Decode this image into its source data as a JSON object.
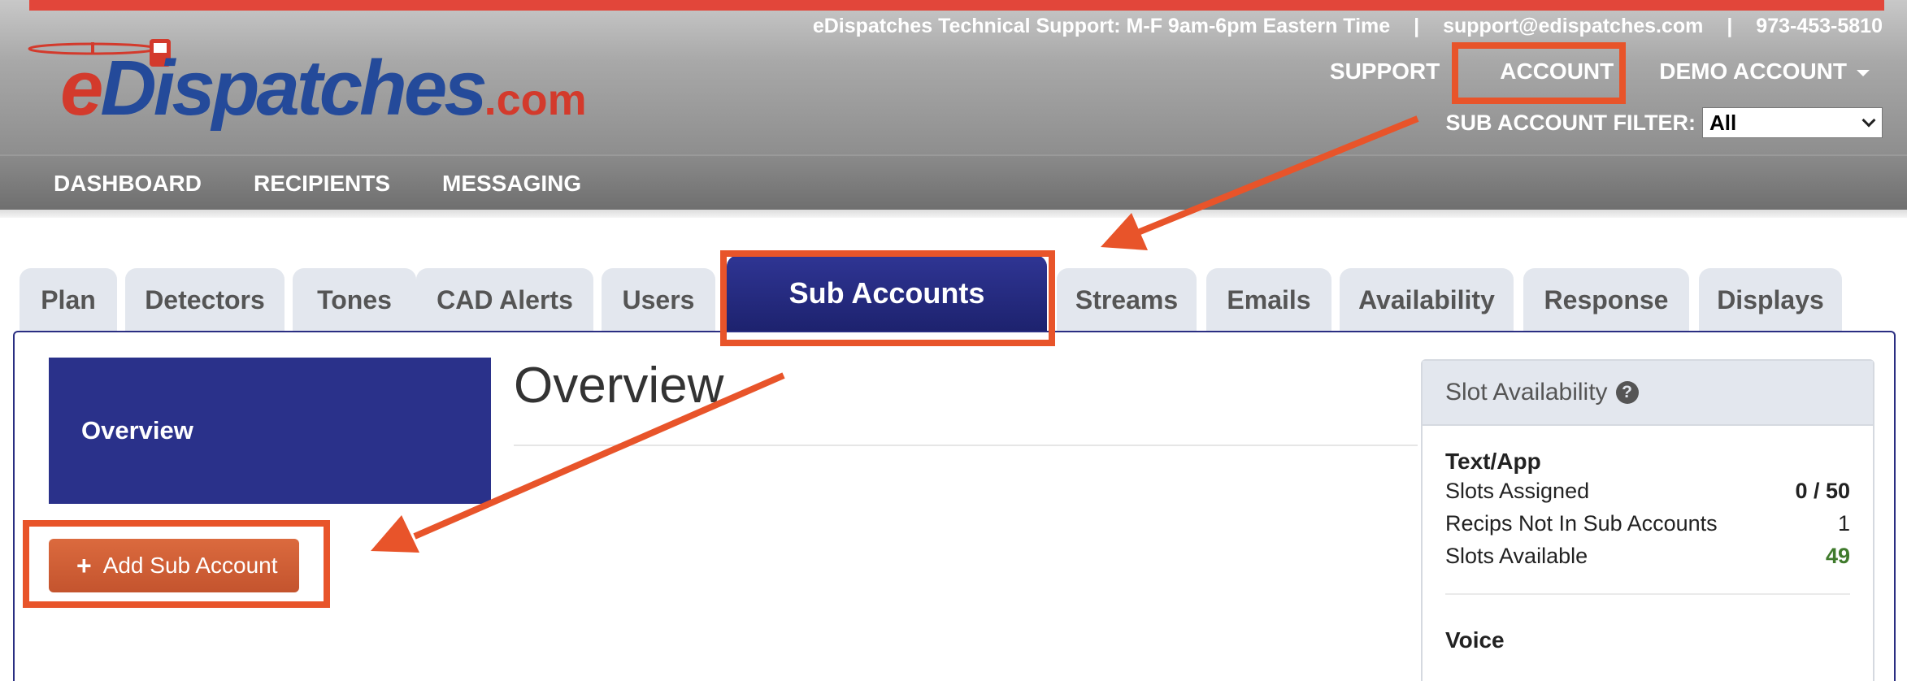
{
  "header": {
    "logo": {
      "prefix": "e",
      "main": "Dispatches",
      "suffix": ".com"
    },
    "support_text": "eDispatches Technical Support: M-F 9am-6pm Eastern Time",
    "support_email": "support@edispatches.com",
    "support_phone": "973-453-5810",
    "separator": "|",
    "top_nav": {
      "support": "SUPPORT",
      "account": "ACCOUNT",
      "demo_account": "DEMO ACCOUNT"
    },
    "sub_account_filter": {
      "label": "SUB ACCOUNT FILTER:",
      "selected": "All"
    }
  },
  "main_nav": {
    "dashboard": "DASHBOARD",
    "recipients": "RECIPIENTS",
    "messaging": "MESSAGING"
  },
  "tabs": [
    {
      "label": "Plan"
    },
    {
      "label": "Detectors"
    },
    {
      "label": "Tones"
    },
    {
      "label": "CAD Alerts"
    },
    {
      "label": "Users"
    },
    {
      "label": "Sub Accounts"
    },
    {
      "label": "Streams"
    },
    {
      "label": "Emails"
    },
    {
      "label": "Availability"
    },
    {
      "label": "Response"
    },
    {
      "label": "Displays"
    }
  ],
  "sidebar": {
    "overview": "Overview",
    "add_button": "Add Sub Account"
  },
  "main": {
    "title": "Overview"
  },
  "slot_availability": {
    "title": "Slot Availability",
    "text_app": {
      "heading": "Text/App",
      "slots_assigned_label": "Slots Assigned",
      "slots_assigned_value": "0 / 50",
      "recips_label": "Recips Not In Sub Accounts",
      "recips_value": "1",
      "slots_available_label": "Slots Available",
      "slots_available_value": "49"
    },
    "voice": {
      "heading": "Voice"
    }
  },
  "colors": {
    "accent": "#e8542a",
    "brand_navy": "#2a318a",
    "button_orange": "#cf5e34",
    "available_green": "#3f7a2c"
  }
}
